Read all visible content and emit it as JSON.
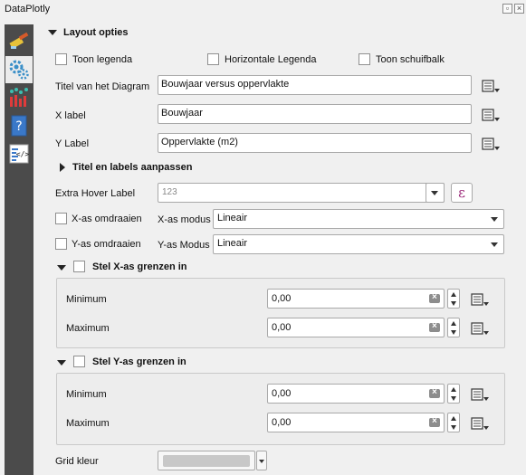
{
  "window": {
    "title": "DataPlotly"
  },
  "sidebar": {
    "items": [
      "style-brush-icon",
      "gears-icon",
      "scatter-bars-icon",
      "help-icon",
      "html-code-icon"
    ]
  },
  "layout_section": {
    "title": "Layout opties"
  },
  "checkboxes": {
    "legend": "Toon legenda",
    "horizontal_legend": "Horizontale Legenda",
    "scrollbar": "Toon schuifbalk"
  },
  "fields": {
    "diagram_title_label": "Titel van het Diagram",
    "diagram_title_value": "Bouwjaar versus oppervlakte",
    "x_label_label": "X label",
    "x_label_value": "Bouwjaar",
    "y_label_label": "Y Label",
    "y_label_value": "Oppervlakte (m2)"
  },
  "titles_section": {
    "title": "Titel en labels aanpassen"
  },
  "hover": {
    "label": "Extra Hover Label",
    "placeholder": "123",
    "expression_symbol": "ε"
  },
  "axes": {
    "x_invert_label": "X-as omdraaien",
    "x_mode_label": "X-as modus",
    "x_mode_value": "Lineair",
    "y_invert_label": "Y-as omdraaien",
    "y_mode_label": "Y-as Modus",
    "y_mode_value": "Lineair"
  },
  "x_bounds": {
    "title": "Stel X-as grenzen in",
    "min_label": "Minimum",
    "min_value": "0,00",
    "max_label": "Maximum",
    "max_value": "0,00"
  },
  "y_bounds": {
    "title": "Stel Y-as grenzen in",
    "min_label": "Minimum",
    "min_value": "0,00",
    "max_label": "Maximum",
    "max_value": "0,00"
  },
  "grid": {
    "label": "Grid kleur",
    "color": "#c8c8c8"
  }
}
